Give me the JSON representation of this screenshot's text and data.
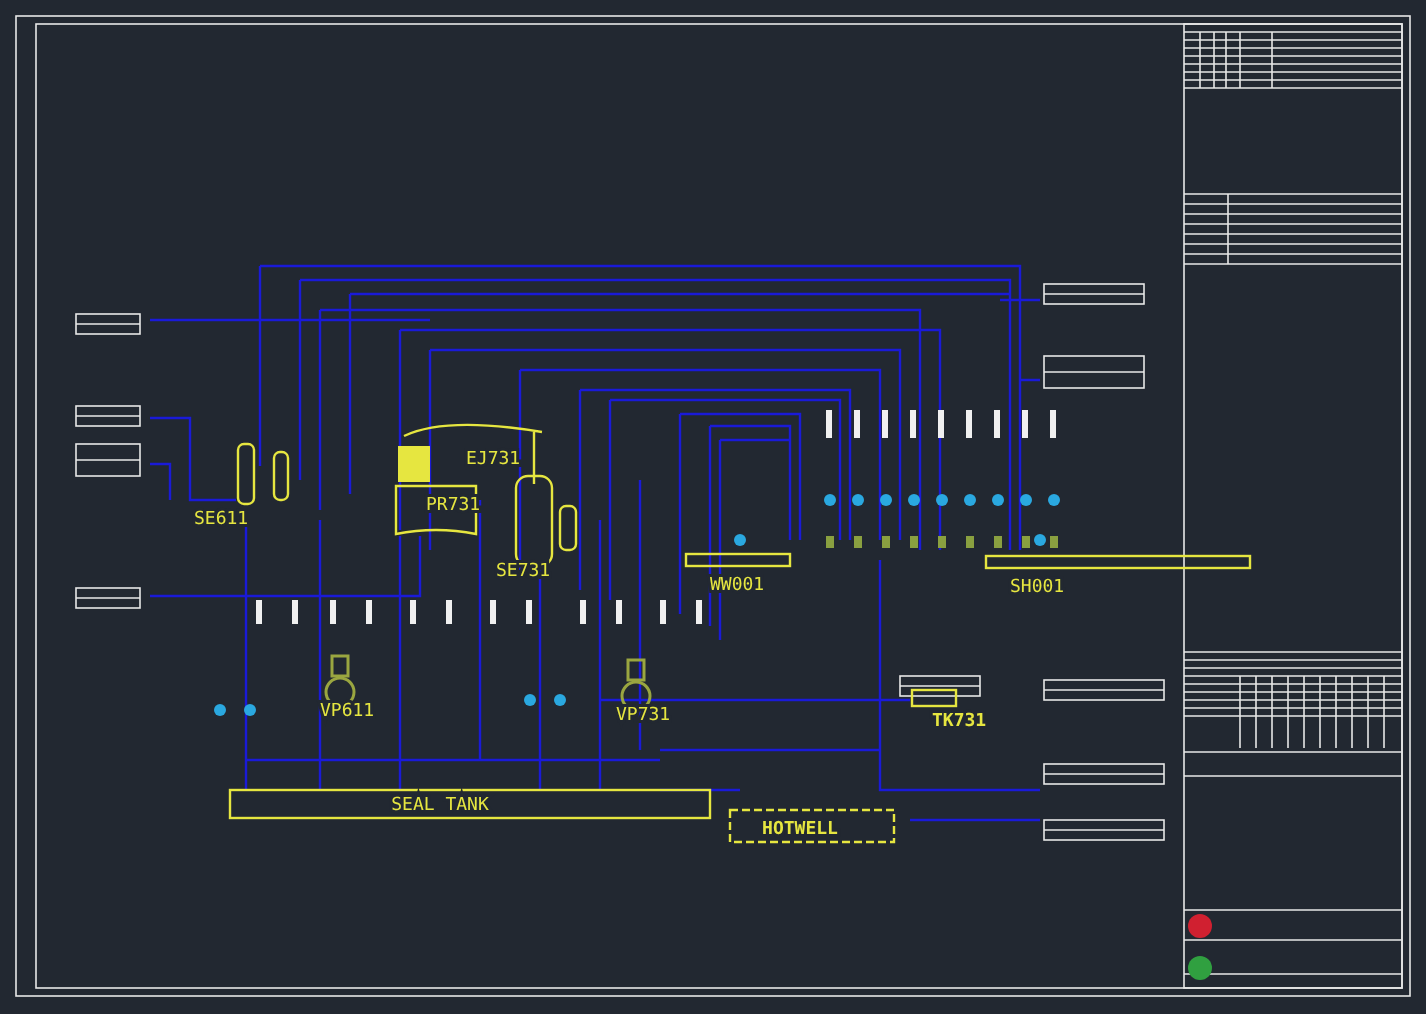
{
  "drawing": {
    "equipment": [
      {
        "tag": "SE611",
        "kind": "exchanger"
      },
      {
        "tag": "PR731",
        "kind": "vessel"
      },
      {
        "tag": "EJ731",
        "kind": "ejector"
      },
      {
        "tag": "SE731",
        "kind": "column"
      },
      {
        "tag": "VP611",
        "kind": "pump"
      },
      {
        "tag": "VP731",
        "kind": "pump"
      },
      {
        "tag": "WW001",
        "kind": "header"
      },
      {
        "tag": "SH001",
        "kind": "header"
      },
      {
        "tag": "SEAL TANK",
        "kind": "tank"
      },
      {
        "tag": "HOTWELL",
        "kind": "hotwell"
      },
      {
        "tag": "TK731",
        "kind": "small-tank"
      }
    ]
  }
}
